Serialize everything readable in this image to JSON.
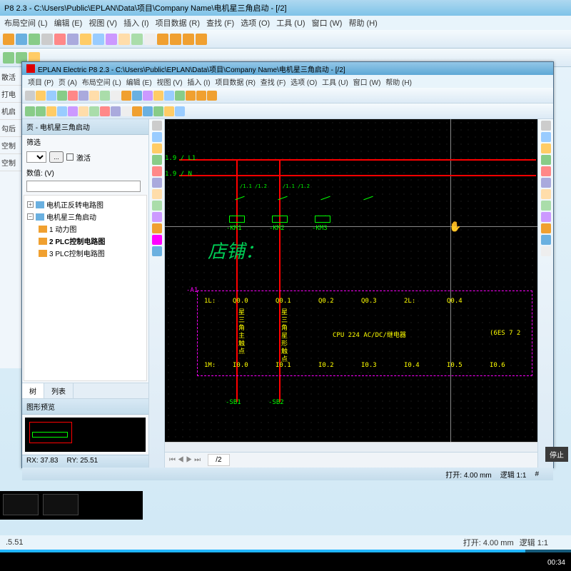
{
  "bg": {
    "title": "P8 2.3 - C:\\Users\\Public\\EPLAN\\Data\\项目\\Company Name\\电机星三角启动 - [/2]",
    "menus": [
      "布局空间 (L)",
      "编辑 (E)",
      "视图 (V)",
      "插入 (I)",
      "项目数据 (R)",
      "查找 (F)",
      "选项 (O)",
      "工具 (U)",
      "窗口 (W)",
      "帮助 (H)"
    ],
    "left_frags": [
      "散活",
      "打电",
      "机启",
      "勾后",
      "空制",
      "空制"
    ],
    "status_l": ".5.51",
    "status_open": "打开: 4.00 mm",
    "status_ratio": "逻辑 1:1"
  },
  "fg": {
    "title": "EPLAN Electric P8 2.3 - C:\\Users\\Public\\EPLAN\\Data\\项目\\Company Name\\电机星三角启动 - [/2]",
    "menus": [
      "项目 (P)",
      "页 (A)",
      "布局空间 (L)",
      "编辑 (E)",
      "视图 (V)",
      "插入 (I)",
      "项目数据 (R)",
      "查找 (F)",
      "选项 (O)",
      "工具 (U)",
      "窗口 (W)",
      "帮助 (H)"
    ],
    "pane_title": "页 - 电机星三角启动",
    "filter_label": "筛选",
    "activate": "激活",
    "value_label": "数值: (V)",
    "tree": [
      {
        "lvl": 1,
        "icon": "blue",
        "exp": "+",
        "label": "电机正反转电路图"
      },
      {
        "lvl": 1,
        "icon": "blue",
        "exp": "-",
        "label": "电机星三角启动"
      },
      {
        "lvl": 2,
        "icon": "",
        "label": "1 动力图"
      },
      {
        "lvl": 2,
        "icon": "",
        "label": "2 PLC控制电路图",
        "bold": true
      },
      {
        "lvl": 2,
        "icon": "",
        "label": "3 PLC控制电路图"
      }
    ],
    "tabs": [
      "树",
      "列表"
    ],
    "preview_title": "图形预览",
    "coord_rx": "RX: 37.83",
    "coord_ry": "RY: 25.51",
    "canvas_tab": "/2",
    "status_open": "打开: 4.00 mm",
    "status_ratio": "逻辑 1:1",
    "status_hash": "#"
  },
  "sch": {
    "l1": "1.9 / L1",
    "n": "1.9 / N",
    "km1": "-KM1",
    "km2": "-KM2",
    "km3": "-KM3",
    "watermark": "店铺：",
    "a1": "-A1",
    "row1": [
      "1L:",
      "Q0.0",
      "Q0.1",
      "Q0.2",
      "Q0.3",
      "2L:",
      "Q0.4"
    ],
    "cpu": "CPU 224 AC/DC/继电器",
    "code": "(6ES 7 2",
    "row2": [
      "1M:",
      "I0.0",
      "I0.1",
      "I0.2",
      "I0.3",
      "I0.4",
      "I0.5",
      "I0.6"
    ],
    "vt1": "星三角主触点",
    "vt2": "星三角星形触点",
    "sb1": "-SB1",
    "sb2": "-SB2",
    "pins": "/1.1\n/1.2"
  },
  "video": {
    "time": "00:34"
  },
  "stop": "停止"
}
